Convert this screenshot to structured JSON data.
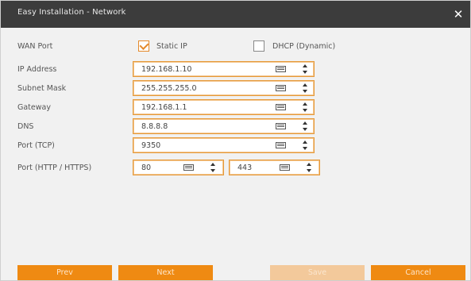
{
  "dialog": {
    "title": "Easy Installation - Network",
    "close_icon": "close-icon"
  },
  "wan_port": {
    "label": "WAN Port",
    "static_ip_label": "Static IP",
    "static_ip_checked": true,
    "dhcp_label": "DHCP (Dynamic)",
    "dhcp_checked": false
  },
  "fields": {
    "ip_address": {
      "label": "IP Address",
      "value": "192.168.1.10"
    },
    "subnet_mask": {
      "label": "Subnet Mask",
      "value": "255.255.255.0"
    },
    "gateway": {
      "label": "Gateway",
      "value": "192.168.1.1"
    },
    "dns": {
      "label": "DNS",
      "value": "8.8.8.8"
    },
    "port_tcp": {
      "label": "Port (TCP)",
      "value": "9350"
    },
    "port_http_https": {
      "label": "Port (HTTP / HTTPS)",
      "http_value": "80",
      "https_value": "443"
    }
  },
  "buttons": {
    "prev": "Prev",
    "next": "Next",
    "save": "Save",
    "cancel": "Cancel"
  },
  "colors": {
    "accent": "#ef8a12",
    "disabled": "#f3c99b",
    "titlebar": "#3c3c3c"
  }
}
